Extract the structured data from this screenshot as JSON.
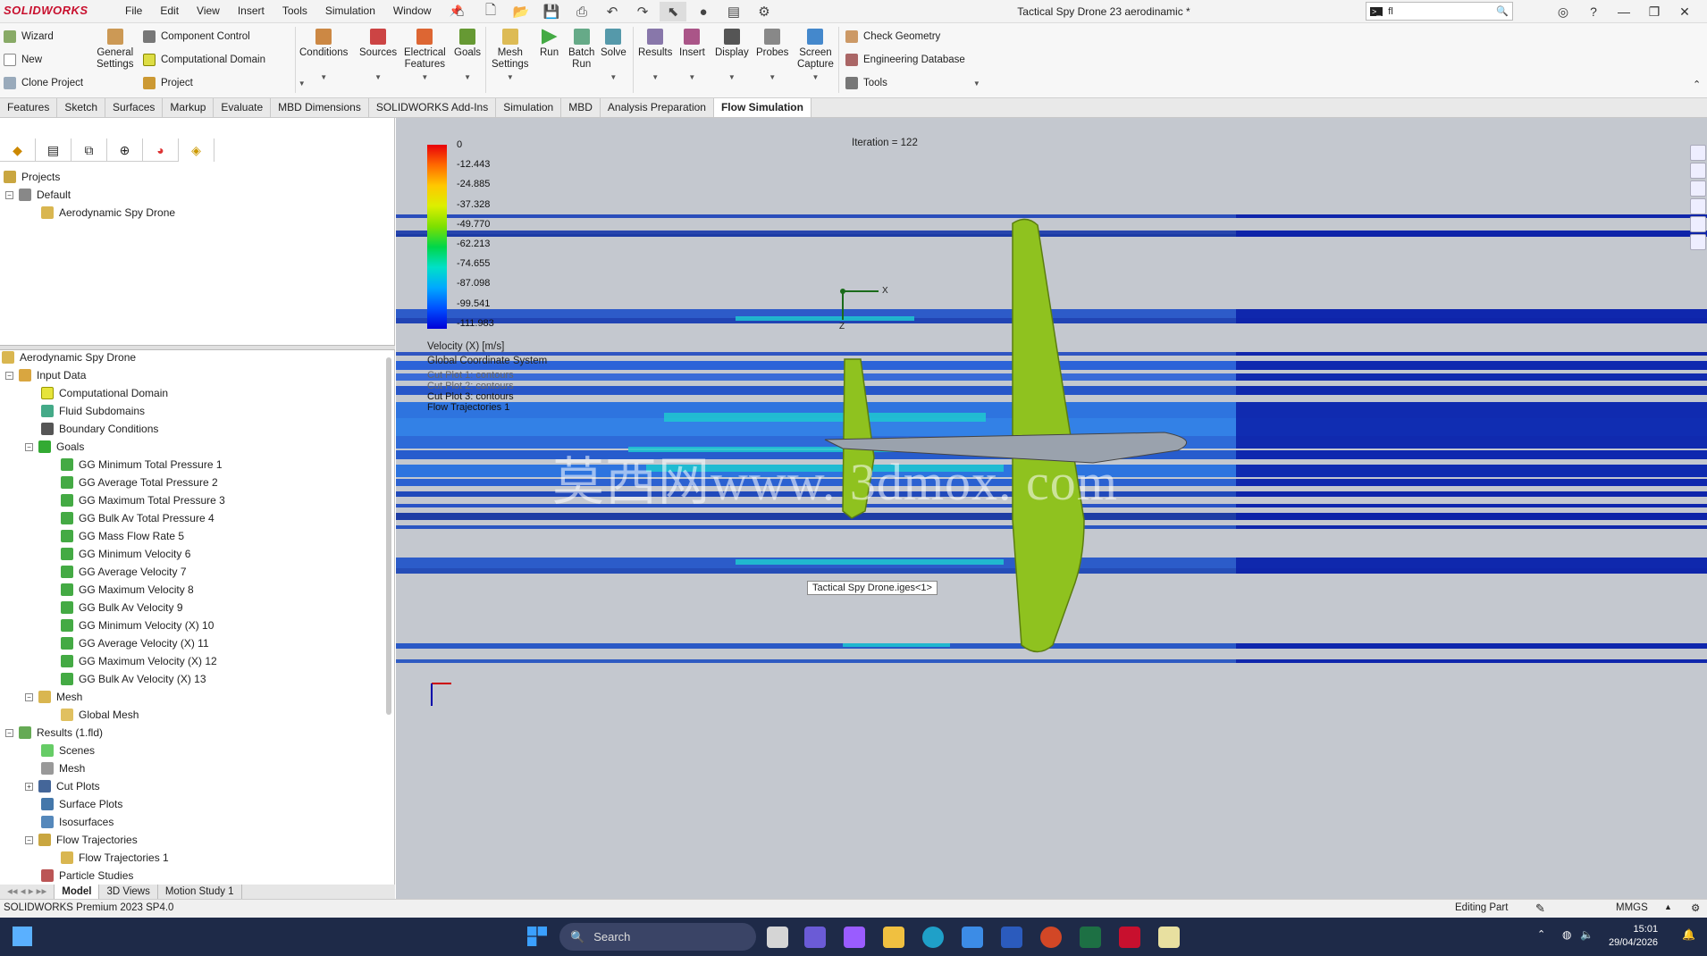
{
  "app": {
    "logo": "SOLIDWORKS",
    "title": "Tactical Spy Drone 23 aerodinamic *",
    "menus": [
      "File",
      "Edit",
      "View",
      "Insert",
      "Tools",
      "Simulation",
      "Window"
    ],
    "search_value": "fl"
  },
  "ribbon": {
    "left_col": [
      "Wizard",
      "New",
      "Clone Project"
    ],
    "general_settings": "General\nSettings",
    "component_col": [
      "Component Control",
      "Computational Domain",
      "Project"
    ],
    "buttons": [
      {
        "label": "Conditions",
        "icon": "conditions-icon"
      },
      {
        "label": "Sources",
        "icon": "sources-icon"
      },
      {
        "label": "Electrical\nFeatures",
        "icon": "electrical-icon"
      },
      {
        "label": "Goals",
        "icon": "goals-icon"
      },
      {
        "label": "Mesh\nSettings",
        "icon": "mesh-icon"
      },
      {
        "label": "Run",
        "icon": "run-icon"
      },
      {
        "label": "Batch\nRun",
        "icon": "batch-run-icon"
      },
      {
        "label": "Solve",
        "icon": "solve-icon"
      },
      {
        "label": "Results",
        "icon": "results-icon"
      },
      {
        "label": "Insert",
        "icon": "insert-icon"
      },
      {
        "label": "Display",
        "icon": "display-icon"
      },
      {
        "label": "Probes",
        "icon": "probes-icon"
      },
      {
        "label": "Screen\nCapture",
        "icon": "screen-capture-icon"
      }
    ],
    "right_col": [
      "Check Geometry",
      "Engineering Database",
      "Tools"
    ]
  },
  "tabs": [
    "Features",
    "Sketch",
    "Surfaces",
    "Markup",
    "Evaluate",
    "MBD Dimensions",
    "SOLIDWORKS Add-Ins",
    "Simulation",
    "MBD",
    "Analysis Preparation",
    "Flow Simulation"
  ],
  "active_tab": "Flow Simulation",
  "projects_tree": {
    "root": "Projects",
    "config": "Default",
    "project": "Aerodynamic Spy Drone"
  },
  "analysis_tree": {
    "root": "Aerodynamic Spy Drone",
    "input_data": "Input Data",
    "input_children": [
      "Computational Domain",
      "Fluid Subdomains",
      "Boundary Conditions"
    ],
    "goals": "Goals",
    "goal_items": [
      "GG Minimum Total Pressure 1",
      "GG Average Total Pressure 2",
      "GG Maximum Total Pressure 3",
      "GG Bulk Av Total Pressure 4",
      "GG Mass Flow Rate 5",
      "GG Minimum Velocity 6",
      "GG Average Velocity 7",
      "GG Maximum Velocity 8",
      "GG Bulk Av Velocity 9",
      "GG Minimum Velocity (X) 10",
      "GG Average Velocity (X) 11",
      "GG Maximum Velocity (X) 12",
      "GG Bulk Av Velocity (X) 13"
    ],
    "mesh": "Mesh",
    "global_mesh": "Global Mesh",
    "results": "Results (1.fld)",
    "result_items": [
      "Scenes",
      "Mesh",
      "Cut Plots",
      "Surface Plots",
      "Isosurfaces",
      "Flow Trajectories"
    ],
    "flow_traj_child": "Flow Trajectories 1",
    "particle": "Particle Studies"
  },
  "bottom_tabs": [
    "Model",
    "3D Views",
    "Motion Study 1"
  ],
  "status": {
    "left": "SOLIDWORKS Premium 2023 SP4.0",
    "mode": "Editing Part",
    "units": "MMGS"
  },
  "viewport": {
    "iteration": "Iteration = 122",
    "legend_values": [
      "0",
      "-12.443",
      "-24.885",
      "-37.328",
      "-49.770",
      "-62.213",
      "-74.655",
      "-87.098",
      "-99.541",
      "-111.983"
    ],
    "legend_colors": [
      "#e8000a",
      "#ff6a00",
      "#ffc800",
      "#dcef00",
      "#7ee000",
      "#00d64a",
      "#00e0c8",
      "#00a8ff",
      "#0050ff",
      "#0000d8"
    ],
    "legend_title": "Velocity (X) [m/s]",
    "coord_system": "Global Coordinate System",
    "plot_list": [
      "Cut Plot 1: contours",
      "Cut Plot 2: contours",
      "Cut Plot 3: contours",
      "Flow Trajectories 1"
    ],
    "tooltip": "Tactical Spy Drone.iges<1>",
    "watermark": "莫西网www. 3dmox. com",
    "axis_x": "X",
    "axis_z": "Z"
  },
  "taskbar": {
    "search": "Search",
    "time": "15:01",
    "date": "29/04/2026"
  }
}
